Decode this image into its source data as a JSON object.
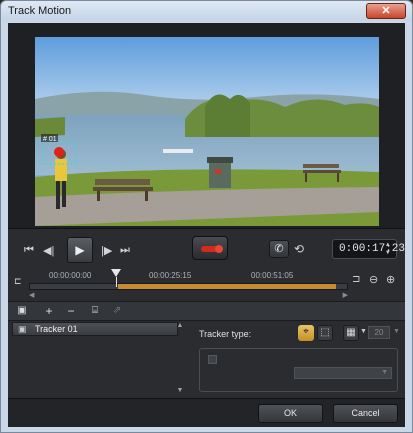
{
  "window": {
    "title": "Track Motion",
    "close_glyph": "✕"
  },
  "preview": {
    "tracker_tag": "# 01"
  },
  "transport": {
    "timecode": "0:00:17:23"
  },
  "timeline": {
    "ruler_labels": [
      "00:00:00:00",
      "00:00:25:15",
      "00:00:51:05"
    ]
  },
  "trackers": {
    "items": [
      {
        "label": "Tracker 01"
      }
    ]
  },
  "properties": {
    "tracker_type_label": "Tracker type:",
    "size_value": "20"
  },
  "dialog": {
    "ok_label": "OK",
    "cancel_label": "Cancel"
  },
  "colors": {
    "accent": "#c68a33",
    "record": "#d42a1e",
    "tracker_box": "#2fe0d0"
  }
}
